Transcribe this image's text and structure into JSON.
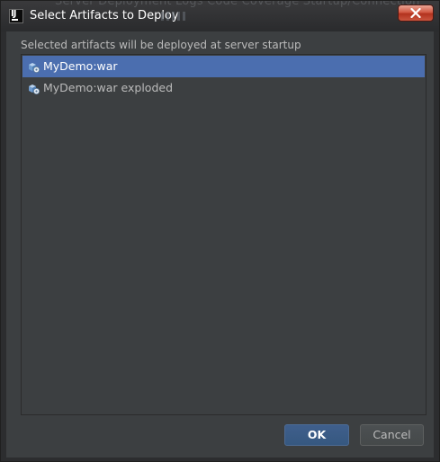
{
  "window": {
    "title": "Select Artifacts to Deploy",
    "background_tabs": "Server   Deployment   Logs   Code Coverage   Startup/Connection"
  },
  "dialog": {
    "instruction": "Selected artifacts will be deployed at server startup",
    "artifacts": [
      {
        "label": "MyDemo:war",
        "selected": true,
        "icon": "artifact-war-icon"
      },
      {
        "label": "MyDemo:war exploded",
        "selected": false,
        "icon": "artifact-war-exploded-icon"
      }
    ]
  },
  "buttons": {
    "ok_label": "OK",
    "cancel_label": "Cancel"
  },
  "colors": {
    "background": "#3c3f41",
    "selection": "#4b6eaf",
    "text": "#bbbbbb",
    "primary_button": "#365880"
  }
}
